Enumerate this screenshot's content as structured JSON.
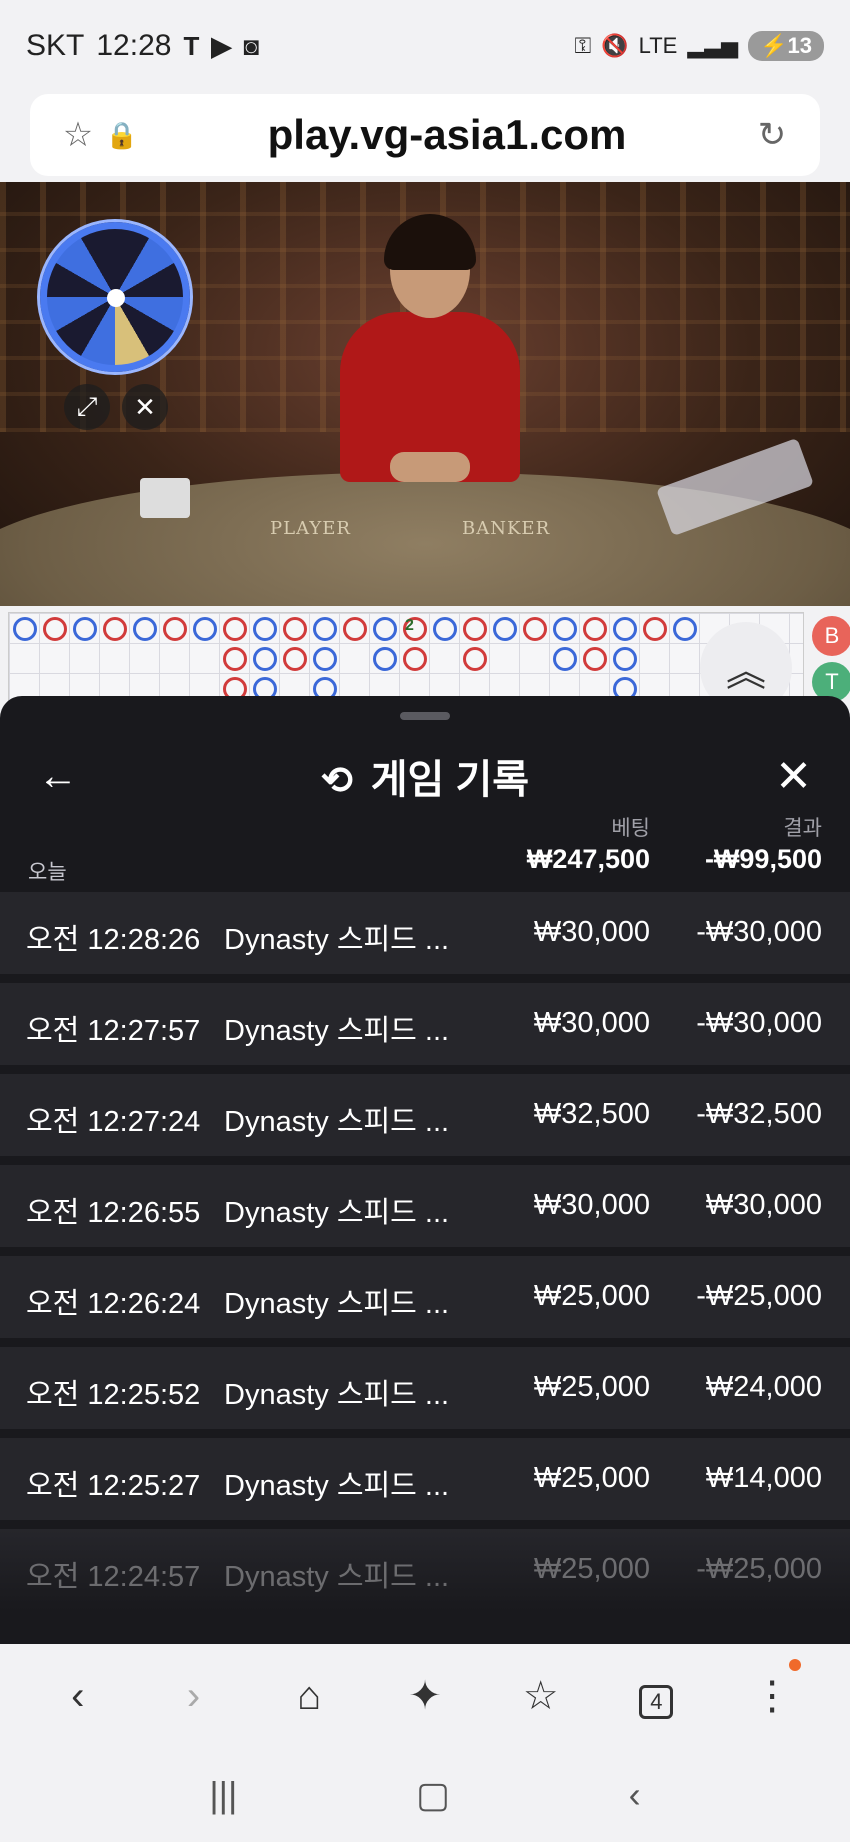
{
  "status_bar": {
    "carrier": "SKT",
    "time": "12:28",
    "network": "LTE",
    "battery": "13"
  },
  "browser": {
    "url": "play.vg-asia1.com",
    "tabs_count": "4"
  },
  "video": {
    "felt_player": "PLAYER",
    "felt_banker": "BANKER"
  },
  "roadmap": {
    "marker": "2",
    "side_chips": [
      {
        "label": "B",
        "color": "#e8645a"
      },
      {
        "label": "T",
        "color": "#4caf7a"
      }
    ]
  },
  "history": {
    "title": "게임 기록",
    "col_bet": "베팅",
    "col_result": "결과",
    "today_label": "오늘",
    "today_bet": "₩247,500",
    "today_result": "-₩99,500",
    "rows": [
      {
        "time": "오전 12:28:26",
        "game": "Dynasty 스피드 ...",
        "bet": "₩30,000",
        "result": "-₩30,000"
      },
      {
        "time": "오전 12:27:57",
        "game": "Dynasty 스피드 ...",
        "bet": "₩30,000",
        "result": "-₩30,000"
      },
      {
        "time": "오전 12:27:24",
        "game": "Dynasty 스피드 ...",
        "bet": "₩32,500",
        "result": "-₩32,500"
      },
      {
        "time": "오전 12:26:55",
        "game": "Dynasty 스피드 ...",
        "bet": "₩30,000",
        "result": "₩30,000"
      },
      {
        "time": "오전 12:26:24",
        "game": "Dynasty 스피드 ...",
        "bet": "₩25,000",
        "result": "-₩25,000"
      },
      {
        "time": "오전 12:25:52",
        "game": "Dynasty 스피드 ...",
        "bet": "₩25,000",
        "result": "₩24,000"
      },
      {
        "time": "오전 12:25:27",
        "game": "Dynasty 스피드 ...",
        "bet": "₩25,000",
        "result": "₩14,000"
      },
      {
        "time": "오전 12:24:57",
        "game": "Dynasty 스피드 ...",
        "bet": "₩25,000",
        "result": "-₩25,000"
      }
    ]
  },
  "colors": {
    "sheet_bg": "#19191d",
    "row_bg": "#26262b",
    "accent_dot": "#f06a2b",
    "banker_red": "#d13b3b",
    "player_blue": "#3b68d8"
  }
}
